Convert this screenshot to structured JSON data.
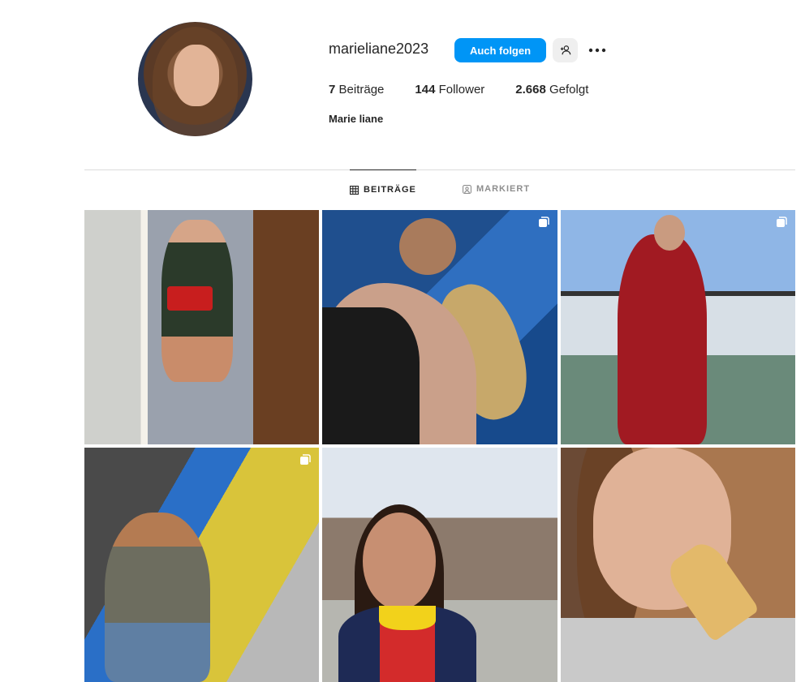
{
  "profile": {
    "username": "marieliane2023",
    "full_name": "Marie liane",
    "follow_label": "Auch folgen",
    "stats": [
      {
        "count": "7",
        "label": "Beiträge"
      },
      {
        "count": "144",
        "label": "Follower"
      },
      {
        "count": "2.668",
        "label": "Gefolgt"
      }
    ]
  },
  "tabs": [
    {
      "label": "BEITRÄGE",
      "icon": "grid-icon",
      "active": true
    },
    {
      "label": "MARKIERT",
      "icon": "tagged-icon",
      "active": false
    }
  ],
  "posts": [
    {
      "subject": "selfie-dress-with-red-purse",
      "multi": false
    },
    {
      "subject": "painting-guitar-mural",
      "multi": true
    },
    {
      "subject": "red-dress-on-balcony",
      "multi": true
    },
    {
      "subject": "painting-canvas",
      "multi": true
    },
    {
      "subject": "selfie-theme-park",
      "multi": false
    },
    {
      "subject": "eating-ice-cream-cone",
      "multi": false
    }
  ],
  "colors": {
    "primary_button": "#0095f6",
    "secondary_button": "#efefef",
    "divider": "#dbdbdb",
    "text": "#262626",
    "muted": "#8e8e8e"
  }
}
